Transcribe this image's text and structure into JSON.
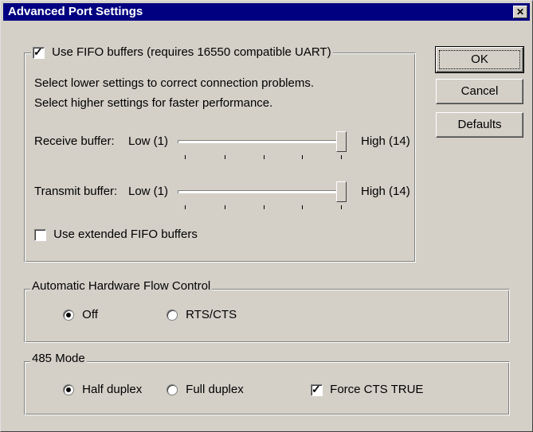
{
  "window": {
    "title": "Advanced Port Settings",
    "close_glyph": "✕"
  },
  "fifo": {
    "use_fifo_label": "Use FIFO buffers (requires 16550 compatible UART)",
    "use_fifo_checked": true,
    "hint1": "Select lower settings to correct connection problems.",
    "hint2": "Select higher settings for faster performance.",
    "receive": {
      "label": "Receive buffer:",
      "low": "Low (1)",
      "high": "High (14)",
      "level": 1.0
    },
    "transmit": {
      "label": "Transmit buffer:",
      "low": "Low (1)",
      "high": "High (14)",
      "level": 1.0
    },
    "extended_label": "Use extended FIFO buffers",
    "extended_checked": false
  },
  "flow": {
    "legend": "Automatic Hardware Flow Control",
    "off_label": "Off",
    "rtscts_label": "RTS/CTS",
    "selected": "Off"
  },
  "mode485": {
    "legend": "485 Mode",
    "half_label": "Half duplex",
    "full_label": "Full duplex",
    "selected": "Half duplex",
    "force_cts_label": "Force CTS TRUE",
    "force_cts_checked": true
  },
  "buttons": {
    "ok": "OK",
    "cancel": "Cancel",
    "defaults": "Defaults"
  }
}
